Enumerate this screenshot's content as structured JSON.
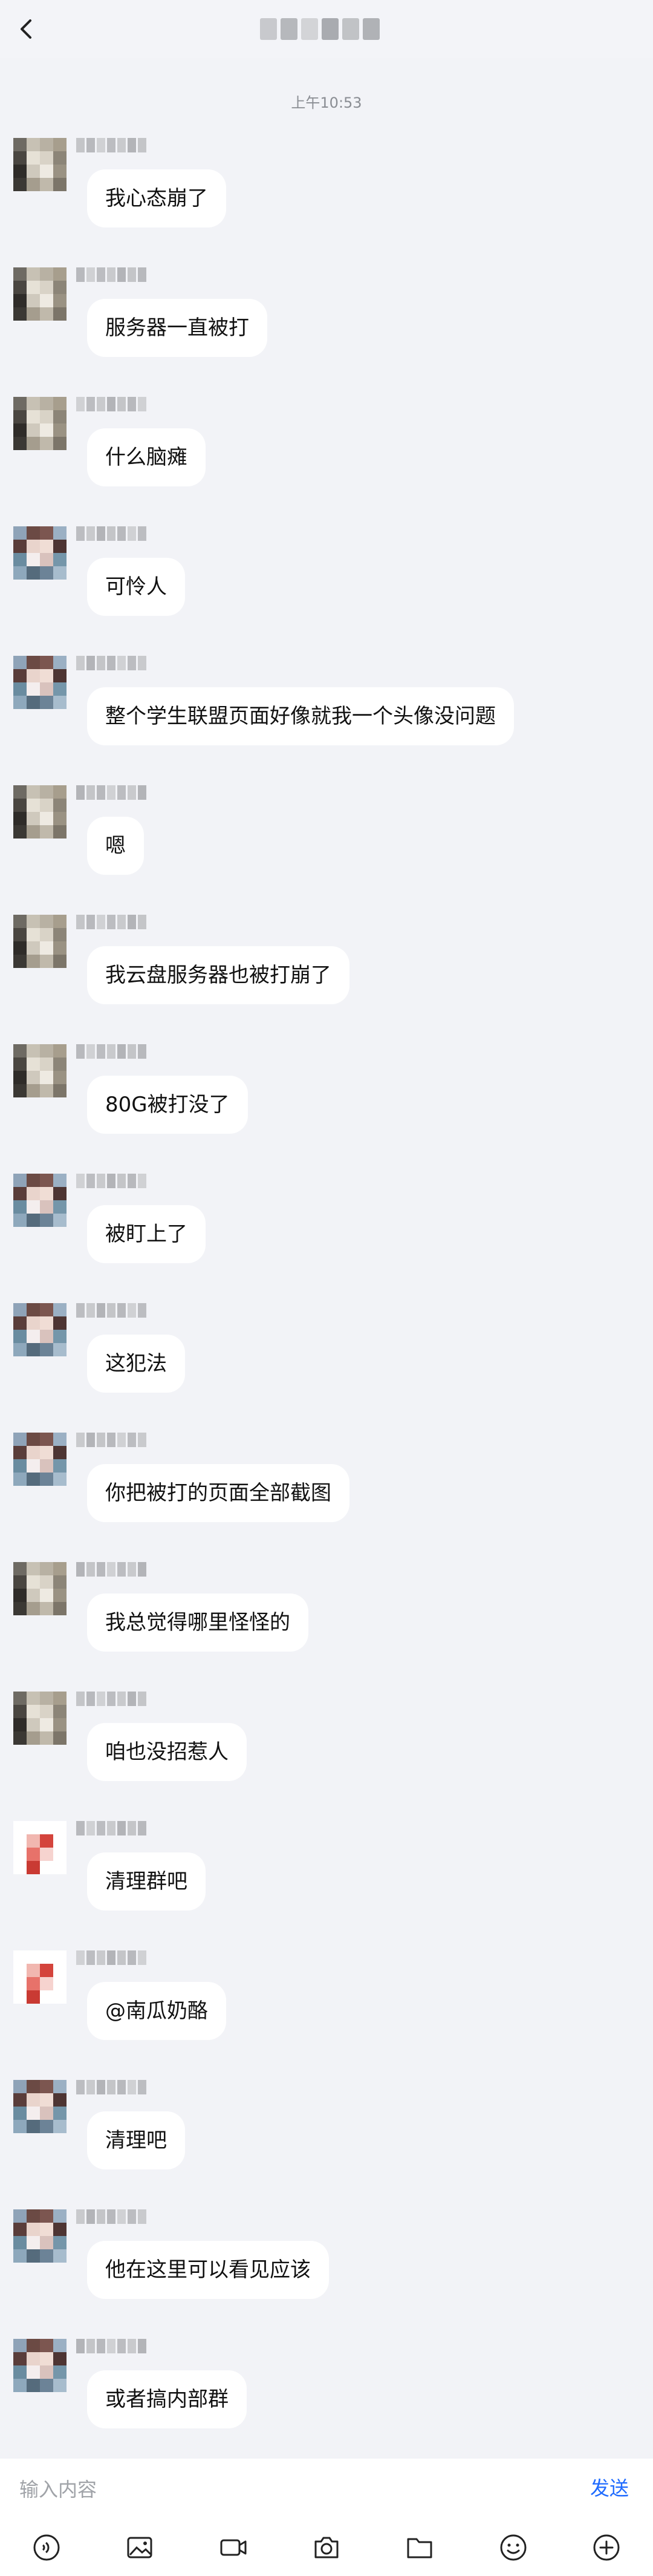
{
  "header": {
    "back_icon": "chevron-left-icon",
    "title": ""
  },
  "timestamp": "上午10:53",
  "messages": [
    {
      "avatar": "pixel-avatar-a",
      "text": "我心态崩了"
    },
    {
      "avatar": "pixel-avatar-a",
      "text": "服务器一直被打"
    },
    {
      "avatar": "pixel-avatar-a",
      "text": "什么脑瘫"
    },
    {
      "avatar": "pixel-avatar-b",
      "text": "可怜人"
    },
    {
      "avatar": "pixel-avatar-b",
      "text": "整个学生联盟页面好像就我一个头像没问题"
    },
    {
      "avatar": "pixel-avatar-a",
      "text": "嗯"
    },
    {
      "avatar": "pixel-avatar-a",
      "text": "我云盘服务器也被打崩了"
    },
    {
      "avatar": "pixel-avatar-a",
      "text": "80G被打没了"
    },
    {
      "avatar": "pixel-avatar-b",
      "text": "被盯上了"
    },
    {
      "avatar": "pixel-avatar-b",
      "text": "这犯法"
    },
    {
      "avatar": "pixel-avatar-b",
      "text": "你把被打的页面全部截图"
    },
    {
      "avatar": "pixel-avatar-a",
      "text": "我总觉得哪里怪怪的"
    },
    {
      "avatar": "pixel-avatar-a",
      "text": "咱也没招惹人"
    },
    {
      "avatar": "pixel-avatar-c",
      "text": "清理群吧"
    },
    {
      "avatar": "pixel-avatar-c",
      "text": "@南瓜奶酪"
    },
    {
      "avatar": "pixel-avatar-b",
      "text": "清理吧"
    },
    {
      "avatar": "pixel-avatar-b",
      "text": "他在这里可以看见应该"
    },
    {
      "avatar": "pixel-avatar-b",
      "text": "或者搞内部群"
    }
  ],
  "input": {
    "placeholder": "输入内容",
    "value": "",
    "send_label": "发送"
  },
  "toolbar": [
    "voice-icon",
    "image-icon",
    "video-icon",
    "camera-icon",
    "folder-icon",
    "emoji-icon",
    "plus-icon"
  ],
  "colors": {
    "background": "#f2f3f7",
    "bubble": "#ffffff",
    "accent": "#1f6bff",
    "text": "#111111"
  }
}
